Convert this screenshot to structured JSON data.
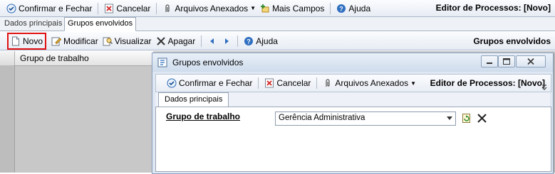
{
  "top_toolbar": {
    "confirm_close": "Confirmar e Fechar",
    "cancel": "Cancelar",
    "attachments": "Arquivos Anexados",
    "more_fields": "Mais Campos",
    "help": "Ajuda",
    "editor_title": "Editor de Processos: [Novo]"
  },
  "tabs": [
    {
      "label": "Dados principais",
      "active": false
    },
    {
      "label": "Grupos envolvidos",
      "active": true
    }
  ],
  "inner_toolbar": {
    "new": "Novo",
    "modify": "Modificar",
    "view": "Visualizar",
    "delete": "Apagar",
    "help": "Ajuda",
    "section_title": "Grupos envolvidos"
  },
  "grid": {
    "columns": [
      "Grupo de trabalho"
    ]
  },
  "dialog": {
    "title": "Grupos envolvidos",
    "toolbar": {
      "confirm_close": "Confirmar e Fechar",
      "cancel": "Cancelar",
      "attachments": "Arquivos Anexados",
      "editor_title": "Editor de Processos: [Novo]"
    },
    "tab": "Dados principais",
    "field_label": "Grupo de trabalho",
    "field_value": "Gerência Administrativa"
  },
  "colors": {
    "highlight": "#e01010",
    "accent": "#1f5fb0"
  }
}
